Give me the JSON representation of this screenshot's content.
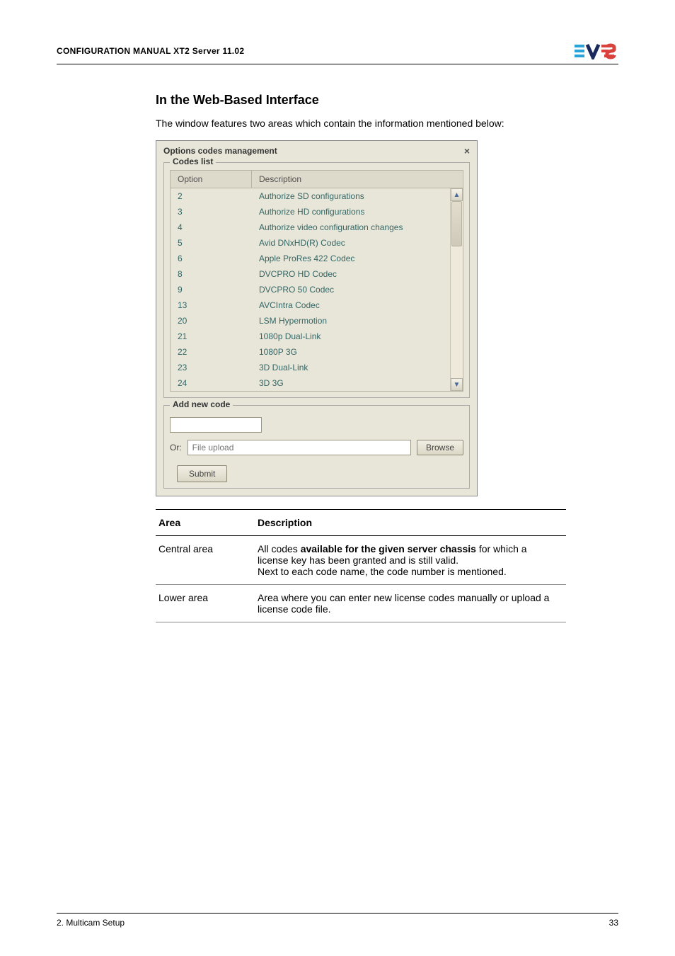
{
  "header": {
    "title": "CONFIGURATION MANUAL   XT2 Server 11.02"
  },
  "section": {
    "heading": "In the Web-Based Interface",
    "intro": "The window features two areas which contain the information mentioned below:"
  },
  "dialog": {
    "title": "Options codes management",
    "codes_legend": "Codes list",
    "col_option": "Option",
    "col_desc": "Description",
    "rows": [
      {
        "opt": "2",
        "desc": "Authorize SD configurations"
      },
      {
        "opt": "3",
        "desc": "Authorize HD configurations"
      },
      {
        "opt": "4",
        "desc": "Authorize video configuration changes"
      },
      {
        "opt": "5",
        "desc": "Avid DNxHD(R) Codec"
      },
      {
        "opt": "6",
        "desc": "Apple ProRes 422 Codec"
      },
      {
        "opt": "8",
        "desc": "DVCPRO HD Codec"
      },
      {
        "opt": "9",
        "desc": "DVCPRO 50 Codec"
      },
      {
        "opt": "13",
        "desc": "AVCIntra Codec"
      },
      {
        "opt": "20",
        "desc": "LSM Hypermotion"
      },
      {
        "opt": "21",
        "desc": "1080p Dual-Link"
      },
      {
        "opt": "22",
        "desc": "1080P 3G"
      },
      {
        "opt": "23",
        "desc": "3D Dual-Link"
      },
      {
        "opt": "24",
        "desc": "3D 3G"
      }
    ],
    "add_legend": "Add new code",
    "or_label": "Or:",
    "file_placeholder": "File upload",
    "browse_label": "Browse",
    "submit_label": "Submit"
  },
  "desc_table": {
    "head_area": "Area",
    "head_desc": "Description",
    "rows": [
      {
        "area": "Central area",
        "pre": "All codes ",
        "bold": "available for the given server chassis",
        "post": " for which a license key has been granted and is still valid.",
        "line2": "Next to each code name, the code number is mentioned."
      },
      {
        "area": "Lower area",
        "text": "Area where you can enter new license codes manually or upload a license code file."
      }
    ]
  },
  "footer": {
    "left": "2. Multicam Setup",
    "right": "33"
  }
}
